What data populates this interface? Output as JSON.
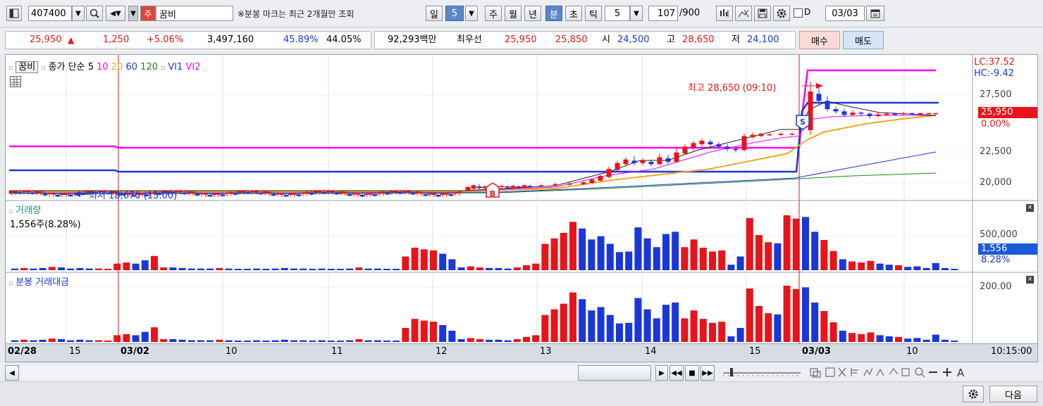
{
  "toolbar": {
    "code": "407400",
    "market_badge": "주",
    "stock_name": "꿈비",
    "notice": "※분봉 마크는 최근 2개월만 조회",
    "periods": [
      "일",
      "5",
      "주",
      "월",
      "년",
      "분",
      "초",
      "틱"
    ],
    "interval": "5",
    "count": "107",
    "count_max": "/900",
    "date_check_label": "D",
    "date_value": "03/03"
  },
  "quote": {
    "price": "25,950",
    "change": "1,250",
    "change_pct": "+5.06%",
    "volume": "3,497,160",
    "ratio1": "45.89%",
    "ratio2": "44.05%",
    "amount": "92,293백만",
    "best_label": "최우선",
    "ask": "25,950",
    "bid": "25,850",
    "open_label": "시",
    "open": "24,500",
    "high_label": "고",
    "high": "28,650",
    "low_label": "저",
    "low": "24,100",
    "buy_label": "매수",
    "sell_label": "매도"
  },
  "price_panel": {
    "title": "꿈비",
    "legend": [
      "종가 단순",
      "5",
      "10",
      "20",
      "60",
      "120",
      "VI1",
      "VI2"
    ],
    "legend_colors": [
      "#000000",
      "#000000",
      "#ff00ff",
      "#f5a623",
      "#1a37d8",
      "#1a8a1a",
      "#1a37d8",
      "#ff00ff"
    ],
    "lc": "LC:37.52",
    "hc": "HC:-9.42",
    "axis_ticks": [
      "27,500",
      "25,000",
      "22,500",
      "20,000"
    ],
    "current_price_tag": "25,950",
    "current_pct": "0.00%",
    "high_note": "최고 28,650 (09:10)",
    "low_note": "최저 18,670 (15:00)",
    "marker_buy": "B",
    "marker_sell": "S"
  },
  "volume_panel": {
    "title": "거래량",
    "current": "1,556주(8.28%)",
    "axis_tick": "500,000",
    "tag": "1,556",
    "tag_pct": "8.28%"
  },
  "amount_panel": {
    "title": "분봉 거래대금",
    "axis_tick": "200.00"
  },
  "x_axis": {
    "labels": [
      "02/28",
      "15",
      "03/02",
      "10",
      "11",
      "12",
      "13",
      "14",
      "15",
      "03/03",
      "10"
    ],
    "time": "10:15:00"
  },
  "footer": {
    "next_label": "다음"
  },
  "colors": {
    "up": "#e8141b",
    "down": "#1a37d8",
    "vi1": "#1a37d8",
    "vi2": "#ff00ff"
  },
  "chart_data": {
    "type": "candlestick",
    "volume_up": [
      0,
      1,
      0,
      0,
      1,
      0,
      0,
      0,
      0,
      1,
      1,
      1,
      1,
      0,
      0,
      1,
      1,
      0,
      0,
      0,
      0,
      0,
      1,
      0,
      0,
      0,
      0,
      0,
      0,
      0,
      0,
      0,
      0,
      0,
      0,
      0,
      0,
      1,
      0,
      0,
      0,
      0,
      1,
      1,
      1,
      1,
      0,
      0,
      0,
      1,
      1,
      0,
      0,
      0,
      1,
      1,
      1,
      1,
      1,
      1,
      1,
      0,
      0,
      0,
      0,
      0,
      0,
      0,
      0,
      0,
      0,
      0,
      1,
      1,
      1,
      1,
      1,
      0,
      0,
      1,
      1,
      1,
      0,
      1,
      1,
      0,
      0,
      1,
      1,
      0,
      1,
      1,
      1,
      0,
      0,
      1,
      0,
      0
    ],
    "volume": [
      0.03,
      0.04,
      0.03,
      0.04,
      0.06,
      0.05,
      0.03,
      0.04,
      0.03,
      0.03,
      0.02,
      0.12,
      0.14,
      0.12,
      0.18,
      0.26,
      0.05,
      0.05,
      0.04,
      0.03,
      0.03,
      0.03,
      0.04,
      0.03,
      0.02,
      0.02,
      0.03,
      0.02,
      0.03,
      0.04,
      0.03,
      0.03,
      0.02,
      0.03,
      0.02,
      0.02,
      0.03,
      0.05,
      0.03,
      0.03,
      0.02,
      0.02,
      0.25,
      0.41,
      0.38,
      0.36,
      0.3,
      0.2,
      0.05,
      0.07,
      0.05,
      0.04,
      0.04,
      0.03,
      0.05,
      0.09,
      0.12,
      0.48,
      0.58,
      0.68,
      0.88,
      0.76,
      0.56,
      0.62,
      0.48,
      0.33,
      0.34,
      0.78,
      0.58,
      0.42,
      0.66,
      0.7,
      0.42,
      0.56,
      0.41,
      0.34,
      0.36,
      0.1,
      0.25,
      0.95,
      0.64,
      0.51,
      0.49,
      1.0,
      0.94,
      0.97,
      0.7,
      0.55,
      0.35,
      0.2,
      0.16,
      0.14,
      0.17,
      0.12,
      0.1,
      0.09,
      0.06,
      0.07,
      0.04,
      0.13,
      0.04,
      0.02
    ],
    "price_axis": [
      20000,
      22500,
      25000,
      27500
    ]
  }
}
